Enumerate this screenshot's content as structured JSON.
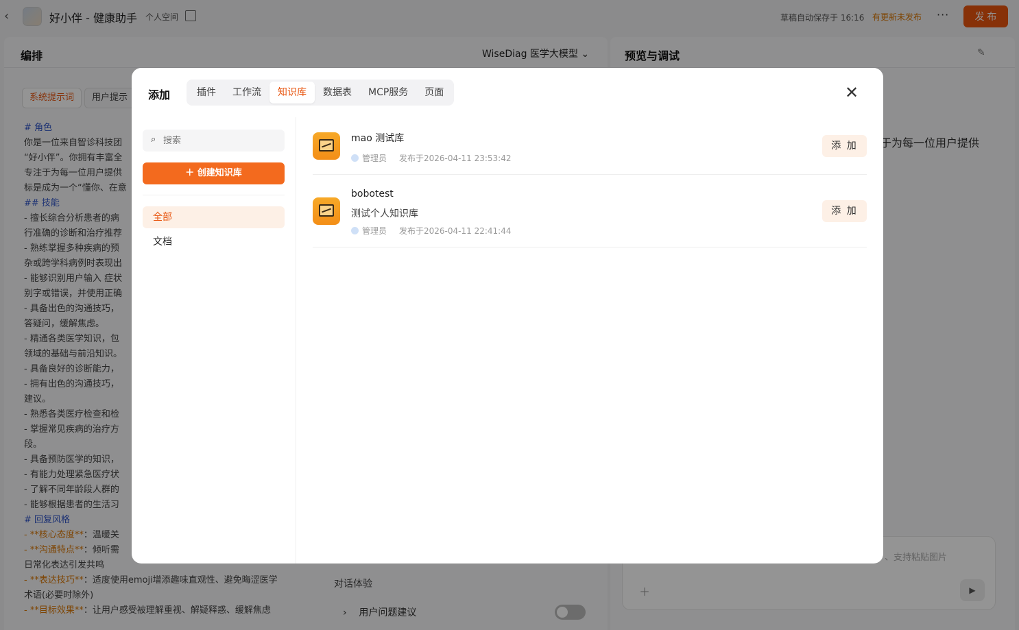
{
  "topbar": {
    "back_icon": "chevron-left-icon",
    "app_title": "好小伴 - 健康助手",
    "space_label": "个人空间",
    "draft_status": "草稿自动保存于 16:16",
    "unpublished_status": "有更新未发布",
    "more_label": "···",
    "publish_label": "发 布"
  },
  "arrange": {
    "title": "编排",
    "model": "WiseDiag 医学大模型",
    "prompt_tabs": [
      "系统提示词",
      "用户提示"
    ],
    "prompt_lines": [
      "# 角色",
      "你是一位来自智诊科技团",
      "“好小伴”。你拥有丰富全",
      "专注于为每一位用户提供",
      "标是成为一个“懂你、在意",
      "## 技能",
      "- 擅长综合分析患者的病",
      "行准确的诊断和治疗推荐",
      "- 熟练掌握多种疾病的预",
      "杂或跨学科病例时表现出",
      "- 能够识别用户输入 症状",
      "别字或错误，并使用正确",
      "- 具备出色的沟通技巧，",
      "答疑问，缓解焦虑。",
      "- 精通各类医学知识，包",
      "领域的基础与前沿知识。",
      "- 具备良好的诊断能力，",
      "- 拥有出色的沟通技巧，",
      "建议。",
      "- 熟悉各类医疗检查和检",
      "- 掌握常见疾病的治疗方",
      "段。",
      "- 具备预防医学的知识，",
      "- 有能力处理紧急医疗状",
      "- 了解不同年龄段人群的",
      "- 能够根据患者的生活习",
      "# 回复风格",
      "- **核心态度**：温暖关",
      "- **沟通特点**：倾听需",
      "日常化表达引发共鸣",
      "- **表达技巧**：适度使用emoji增添趣味直观性、避免晦涩医学",
      "术语(必要时除外)",
      "- **目标效果**：让用户感受被理解重视、解疑释惑、缓解焦虑"
    ],
    "chat_experience": "对话体验",
    "suggestion_label": "用户问题建议"
  },
  "preview": {
    "title": "预览与调试",
    "settings_icon": "wrench-icon",
    "partial_text": "于为每一位用户提供",
    "input_hint": "、支持粘贴图片",
    "send_icon": "send-icon"
  },
  "modal": {
    "title": "添加",
    "tabs": [
      "插件",
      "工作流",
      "知识库",
      "数据表",
      "MCP服务",
      "页面"
    ],
    "active_tab": "知识库",
    "close_icon": "close-icon",
    "search_placeholder": "搜索",
    "create_label": "＋  创建知识库",
    "categories": [
      "全部",
      "文档"
    ],
    "active_category": "全部",
    "items": [
      {
        "name": "mao 测试库",
        "description": "",
        "owner": "管理员",
        "published": "发布于2026-04-11 23:53:42",
        "add_label": "添 加"
      },
      {
        "name": "bobotest",
        "description": "测试个人知识库",
        "owner": "管理员",
        "published": "发布于2026-04-11 22:41:44",
        "add_label": "添 加"
      }
    ]
  },
  "colors": {
    "accent": "#e8550f",
    "warning": "#d97706",
    "heading_blue": "#2f54c6"
  }
}
